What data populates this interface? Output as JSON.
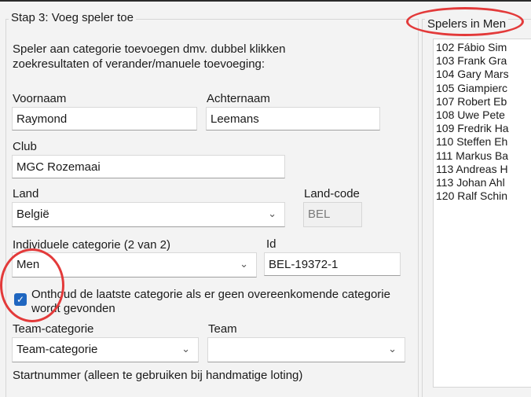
{
  "step_group": {
    "title": "Stap 3: Voeg speler toe",
    "instructions": "Speler aan categorie toevoegen dmv. dubbel klikken zoekresultaten of verander/manuele toevoeging:"
  },
  "form": {
    "voornaam_label": "Voornaam",
    "voornaam_value": "Raymond",
    "achternaam_label": "Achternaam",
    "achternaam_value": "Leemans",
    "club_label": "Club",
    "club_value": "MGC Rozemaai",
    "land_label": "Land",
    "land_value": "België",
    "landcode_label": "Land-code",
    "landcode_value": "BEL",
    "indiv_cat_label": "Individuele categorie (2 van 2)",
    "indiv_cat_value": "Men",
    "id_label": "Id",
    "id_value": "BEL-19372-1",
    "remember_checked": true,
    "remember_label": "Onthoud de laatste categorie als er geen overeenkomende categorie wordt gevonden",
    "team_cat_label": "Team-categorie",
    "team_cat_value": "Team-categorie",
    "team_label": "Team",
    "team_value": "",
    "startnummer_label": "Startnummer (alleen te gebruiken bij handmatige loting)"
  },
  "players_group": {
    "title": "Spelers in Men",
    "items": [
      "102 Fábio Sim",
      "103 Frank Gra",
      "104 Gary Mars",
      "105 Giampierc",
      "107 Robert Eb",
      "108 Uwe Pete",
      "109 Fredrik Ha",
      "110 Steffen Eh",
      "111 Markus Ba",
      "113 Andreas H",
      "113 Johan Ahl",
      "120 Ralf Schin"
    ]
  },
  "icons": {
    "dropdown": "chevron-down-icon",
    "check": "checkmark-icon"
  },
  "colors": {
    "accent": "#1f66c0",
    "highlight": "#e33a3a"
  }
}
